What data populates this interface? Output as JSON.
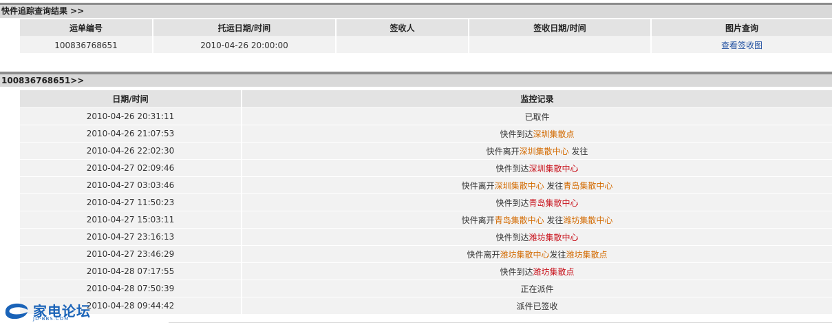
{
  "summary": {
    "title": "快件追踪查询结果 >>",
    "headers": [
      "运单编号",
      "托运日期/时间",
      "签收人",
      "签收日期/时间",
      "图片查询"
    ],
    "row": {
      "waybill": "100836768651",
      "ship_time": "2010-04-26 20:00:00",
      "signer": "",
      "sign_time": "",
      "image_link": "查看签收图"
    }
  },
  "tracking": {
    "title": "100836768651>>",
    "headers": [
      "日期/时间",
      "监控记录"
    ],
    "rows": [
      {
        "time": "2010-04-26 20:31:11",
        "parts": [
          {
            "t": "已取件",
            "c": ""
          }
        ]
      },
      {
        "time": "2010-04-26 21:07:53",
        "parts": [
          {
            "t": "快件到达",
            "c": ""
          },
          {
            "t": "深圳集散点",
            "c": "loc"
          }
        ]
      },
      {
        "time": "2010-04-26 22:02:30",
        "parts": [
          {
            "t": "快件离开",
            "c": ""
          },
          {
            "t": "深圳集散中心",
            "c": "loc"
          },
          {
            "t": " 发往",
            "c": ""
          }
        ]
      },
      {
        "time": "2010-04-27 02:09:46",
        "parts": [
          {
            "t": "快件到达",
            "c": ""
          },
          {
            "t": "深圳集散中心",
            "c": "loc-red"
          }
        ]
      },
      {
        "time": "2010-04-27 03:03:46",
        "parts": [
          {
            "t": "快件离开",
            "c": ""
          },
          {
            "t": "深圳集散中心",
            "c": "loc"
          },
          {
            "t": " 发往",
            "c": ""
          },
          {
            "t": "青岛集散中心",
            "c": "loc"
          }
        ]
      },
      {
        "time": "2010-04-27 11:50:23",
        "parts": [
          {
            "t": "快件到达",
            "c": ""
          },
          {
            "t": "青岛集散中心",
            "c": "loc-red"
          }
        ]
      },
      {
        "time": "2010-04-27 15:03:11",
        "parts": [
          {
            "t": "快件离开",
            "c": ""
          },
          {
            "t": "青岛集散中心",
            "c": "loc"
          },
          {
            "t": " 发往",
            "c": ""
          },
          {
            "t": "潍坊集散中心",
            "c": "loc"
          }
        ]
      },
      {
        "time": "2010-04-27 23:16:13",
        "parts": [
          {
            "t": "快件到达",
            "c": ""
          },
          {
            "t": "潍坊集散中心",
            "c": "loc-red"
          }
        ]
      },
      {
        "time": "2010-04-27 23:46:29",
        "parts": [
          {
            "t": "快件离开",
            "c": ""
          },
          {
            "t": "潍坊集散中心",
            "c": "loc"
          },
          {
            "t": "发往",
            "c": ""
          },
          {
            "t": "潍坊集散点",
            "c": "loc"
          }
        ]
      },
      {
        "time": "2010-04-28 07:17:55",
        "parts": [
          {
            "t": "快件到达",
            "c": ""
          },
          {
            "t": "潍坊集散点",
            "c": "loc-red"
          }
        ]
      },
      {
        "time": "2010-04-28 07:50:39",
        "parts": [
          {
            "t": "正在派件",
            "c": ""
          }
        ]
      },
      {
        "time": "2010-04-28 09:44:42",
        "parts": [
          {
            "t": "派件已签收",
            "c": ""
          }
        ]
      }
    ]
  },
  "watermark": {
    "icon": "jd-bbs-logo-icon",
    "name": "家电论坛",
    "domain": "JD-BBS.COM"
  },
  "colors": {
    "location": "#d36a00",
    "location_arrived": "#c8101a",
    "link": "#1f4fa0"
  }
}
